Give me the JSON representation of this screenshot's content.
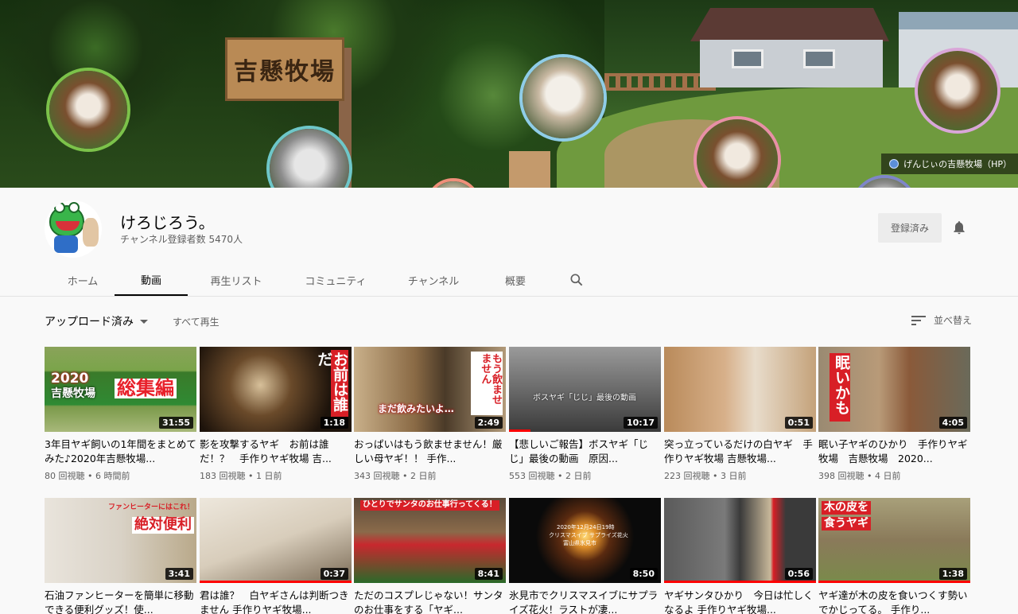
{
  "banner": {
    "sign_text": "吉懸牧場",
    "link_text": "げんじぃの吉懸牧場（HP）",
    "link_icon": "globe-icon"
  },
  "channel": {
    "name": "けろじろう。",
    "subscribers": "チャンネル登録者数 5470人",
    "subscribe_label": "登録済み",
    "bell_icon": "bell-icon"
  },
  "tabs": [
    {
      "label": "ホーム",
      "active": false
    },
    {
      "label": "動画",
      "active": true
    },
    {
      "label": "再生リスト",
      "active": false
    },
    {
      "label": "コミュニティ",
      "active": false
    },
    {
      "label": "チャンネル",
      "active": false
    },
    {
      "label": "概要",
      "active": false
    }
  ],
  "toolbar": {
    "filter_label": "アップロード済み",
    "play_all_label": "すべて再生",
    "sort_label": "並べ替え"
  },
  "videos": [
    {
      "title": "3年目ヤギ飼いの1年間をまとめてみた♪2020年吉懸牧場...",
      "views": "80 回視聴",
      "age": "6 時間前",
      "duration": "31:55",
      "overlay": [
        "2020",
        "吉懸牧場",
        "総集編"
      ],
      "watched": 0
    },
    {
      "title": "影を攻撃するヤギ　お前は誰だ！？　手作りヤギ牧場 吉...",
      "views": "183 回視聴",
      "age": "1 日前",
      "duration": "1:18",
      "overlay": [
        "お前は誰だ"
      ],
      "watched": 0
    },
    {
      "title": "おっぱいはもう飲ませません！厳しい母ヤギ！！ 手作...",
      "views": "343 回視聴",
      "age": "2 日前",
      "duration": "2:49",
      "overlay": [
        "もう飲ませません",
        "まだ飲みたいよ…"
      ],
      "watched": 0
    },
    {
      "title": "【悲しいご報告】ボスヤギ「じじ」最後の動画　原因...",
      "views": "553 回視聴",
      "age": "2 日前",
      "duration": "10:17",
      "overlay": [
        "ボスヤギ「じじ」最後の動画"
      ],
      "watched": 0.14
    },
    {
      "title": "突っ立っているだけの白ヤギ　手作りヤギ牧場 吉懸牧場...",
      "views": "223 回視聴",
      "age": "3 日前",
      "duration": "0:51",
      "overlay": [],
      "watched": 0
    },
    {
      "title": "眠い子ヤギのひかり　手作りヤギ牧場　吉懸牧場　2020...",
      "views": "398 回視聴",
      "age": "4 日前",
      "duration": "4:05",
      "overlay": [
        "眠いかも"
      ],
      "watched": 0
    },
    {
      "title": "石油ファンヒーターを簡単に移動できる便利グッズ！使...",
      "views": "",
      "age": "",
      "duration": "3:41",
      "overlay": [
        "ファンヒーターにはこれ！",
        "絶対便利"
      ],
      "watched": 0
    },
    {
      "title": "君は誰？　白ヤギさんは判断つきません 手作りヤギ牧場...",
      "views": "",
      "age": "",
      "duration": "0:37",
      "overlay": [],
      "watched": 1
    },
    {
      "title": "ただのコスプレじゃない！サンタのお仕事をする「ヤギ...",
      "views": "",
      "age": "",
      "duration": "8:41",
      "overlay": [
        "ひとりでサンタのお仕事行ってくる！"
      ],
      "watched": 0
    },
    {
      "title": "氷見市でクリスマスイブにサプライズ花火！ラストが凄...",
      "views": "",
      "age": "",
      "duration": "8:50",
      "overlay": [
        "2020年12月24日19時",
        "クリスマスイブ サプライズ花火",
        "富山県氷見市"
      ],
      "watched": 0
    },
    {
      "title": "ヤギサンタひかり　今日は忙しくなるよ 手作りヤギ牧場...",
      "views": "",
      "age": "",
      "duration": "0:56",
      "overlay": [],
      "watched": 1
    },
    {
      "title": "ヤギ達が木の皮を食いつくす勢いでかじってる。 手作り...",
      "views": "",
      "age": "",
      "duration": "1:38",
      "overlay": [
        "木の皮を",
        "食うヤギ"
      ],
      "watched": 1
    }
  ]
}
